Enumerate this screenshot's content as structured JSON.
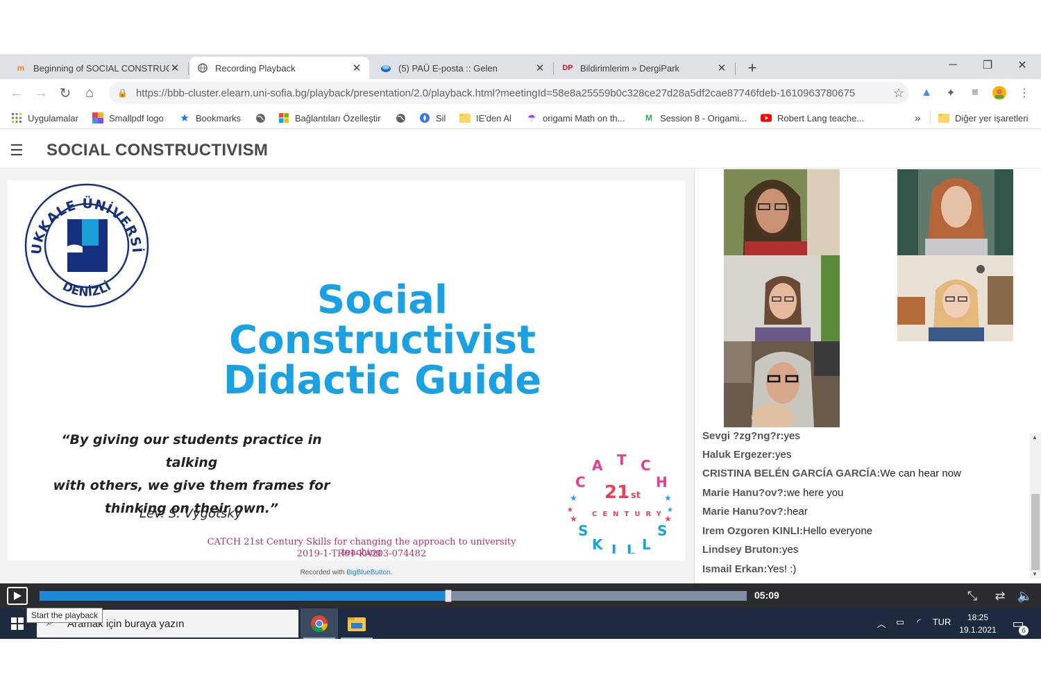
{
  "browser": {
    "tabs": [
      {
        "label": "Beginning of SOCIAL CONSTRUC",
        "icon": "moodle-icon",
        "active": false
      },
      {
        "label": "Recording Playback",
        "icon": "globe-icon",
        "active": true
      },
      {
        "label": "(5) PAÜ E-posta :: Gelen",
        "icon": "roundcube-icon",
        "active": false
      },
      {
        "label": "Bildirimlerim » DergiPark",
        "icon": "dergipark-icon",
        "active": false
      }
    ],
    "new_tab_glyph": "+",
    "url": "https://bbb-cluster.elearn.uni-sofia.bg/playback/presentation/2.0/playback.html?meetingId=58e8a25559b0c328ce27d28a5df2cae87746fdeb-1610963780675",
    "bookmarks": [
      {
        "label": "Uygulamalar",
        "icon": "apps-grid-icon"
      },
      {
        "label": "Smallpdf logo",
        "icon": "smallpdf-icon"
      },
      {
        "label": "Bookmarks",
        "icon": "star-icon"
      },
      {
        "label": "",
        "icon": "globe-icon"
      },
      {
        "label": "Bağlantıları Özelleştir",
        "icon": "windows-logo-icon"
      },
      {
        "label": "",
        "icon": "globe-icon"
      },
      {
        "label": "Sil",
        "icon": "compass-icon"
      },
      {
        "label": "IE'den Al",
        "icon": "folder-icon"
      },
      {
        "label": "origami Math on th...",
        "icon": "umbrella-icon"
      },
      {
        "label": "Session 8 - Origami...",
        "icon": "m-logo-icon"
      },
      {
        "label": "Robert Lang teache...",
        "icon": "youtube-icon"
      }
    ],
    "overflow_glyph": "»",
    "other_bookmarks": "Diğer yer işaretleri"
  },
  "page": {
    "title": "SOCIAL CONSTRUCTIVISM"
  },
  "slide": {
    "university_ring_text": "PAMUKKALE ÜNİVERSİTESİ",
    "university_city": "DENİZLİ",
    "title_lines": [
      "Social",
      "Constructivist",
      "Didactic Guide"
    ],
    "quote_lines": [
      "“By giving our students practice in talking",
      "with others, we give them frames for",
      "thinking on their own.”"
    ],
    "quote_author": "Lev. S. Vygotsky",
    "project_line1": "CATCH 21st Century Skills for changing the approach to university teaching",
    "project_line2": "2019-1-TR01-KA203-074482",
    "catch_logo": {
      "letters_top": [
        "C",
        "A",
        "T",
        "C",
        "H"
      ],
      "center_number": "21",
      "center_suffix": "st",
      "century": "CENTURY",
      "letters_bottom": [
        "S",
        "K",
        "I",
        "L",
        "L",
        "S"
      ]
    }
  },
  "recorded_with": {
    "prefix": "Recorded with ",
    "brand": "BigBlueButton."
  },
  "chat": [
    {
      "user": "Sevgi ?zg?ng?r:",
      "text": "yes"
    },
    {
      "user": "Haluk Ergezer:",
      "text": "yes"
    },
    {
      "user": "CRISTINA BELÉN GARCÍA GARCÍA:",
      "text": "We can hear now"
    },
    {
      "user": "Marie Hanu?ov?:",
      "text": "we here you"
    },
    {
      "user": "Marie Hanu?ov?:",
      "text": "hear"
    },
    {
      "user": "Irem Ozgoren KINLI:",
      "text": "Hello everyone"
    },
    {
      "user": "Lindsey Bruton:",
      "text": "yes"
    },
    {
      "user": "Ismail Erkan:",
      "text": "Yes! :)"
    }
  ],
  "player": {
    "time": "05:09",
    "progress_fraction": 0.578,
    "play_tooltip": "Start the playback"
  },
  "taskbar": {
    "search_placeholder": "Aramak için buraya yazın",
    "language": "TUR",
    "time": "18:25",
    "date": "19.1.2021",
    "notification_count": "6"
  },
  "colors": {
    "slide_title": "#1ba1e2",
    "progress_fill": "#1e88d8",
    "taskbar": "#1e2b3e",
    "player_bar": "#2a2c30",
    "project_text": "#b0306a"
  }
}
